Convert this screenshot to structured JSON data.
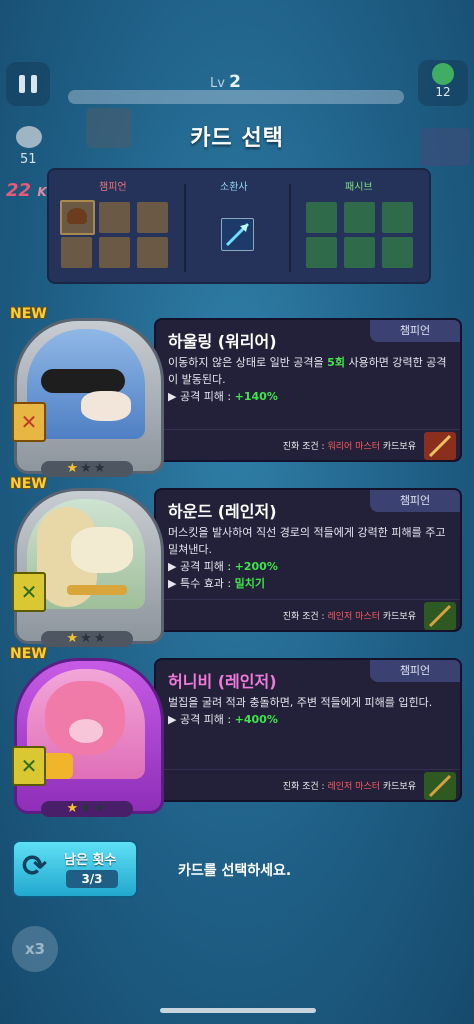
{
  "hud": {
    "level_prefix": "Lv",
    "level": "2",
    "timer_value": "12",
    "kill_count": "51",
    "combo_count": "22",
    "combo_suffix": "Kill"
  },
  "title": "카드 선택",
  "deck": {
    "champion_header": "챔피언",
    "summoner_header": "소환사",
    "passive_header": "패시브"
  },
  "cards": [
    {
      "new_label": "NEW",
      "name": "하울링 (워리어)",
      "role": "챔피언",
      "desc_pre": "이동하지 않은 상태로 일반 공격을 ",
      "desc_hl": "5회",
      "desc_post": " 사용하면 강력한 공격이 발동된다.",
      "stats": [
        {
          "label": "▶ 공격 피해 : ",
          "value": "+140%"
        }
      ],
      "evo_prefix": "진화 조건 : ",
      "evo_highlight": "워리어 마스터",
      "evo_suffix": " 카드보유",
      "stars_filled": 1,
      "stars_total": 3,
      "class_icon": "warrior-crossed-swords-icon"
    },
    {
      "new_label": "NEW",
      "name": "하운드 (레인저)",
      "role": "챔피언",
      "desc": "머스킷을 발사하여 직선 경로의 적들에게 강력한 피해를 주고 밀쳐낸다.",
      "stats": [
        {
          "label": "▶ 공격 피해 : ",
          "value": "+200%"
        },
        {
          "label": "▶ 특수 효과 : ",
          "value": "밀치기"
        }
      ],
      "evo_prefix": "진화 조건 : ",
      "evo_highlight": "레인저 마스터",
      "evo_suffix": " 카드보유",
      "stars_filled": 1,
      "stars_total": 3,
      "class_icon": "ranger-bow-icon"
    },
    {
      "new_label": "NEW",
      "name": "허니비 (레인저)",
      "role": "챔피언",
      "desc": "벌집을 굴려 적과 충돌하면, 주변 적들에게 피해를 입힌다.",
      "stats": [
        {
          "label": "▶ 공격 피해 : ",
          "value": "+400%"
        }
      ],
      "evo_prefix": "진화 조건 : ",
      "evo_highlight": "레인저 마스터",
      "evo_suffix": " 카드보유",
      "stars_filled": 1,
      "stars_total": 3,
      "class_icon": "ranger-bow-icon"
    }
  ],
  "reroll": {
    "label": "남은 횟수",
    "count": "3/3"
  },
  "prompt": "카드를 선택하세요.",
  "speed_label": "x3",
  "colors": {
    "accent_green": "#3ee44a",
    "evo_red": "#ff5a5a",
    "new_yellow": "#f5d23b",
    "name_pink": "#f07ad8"
  }
}
